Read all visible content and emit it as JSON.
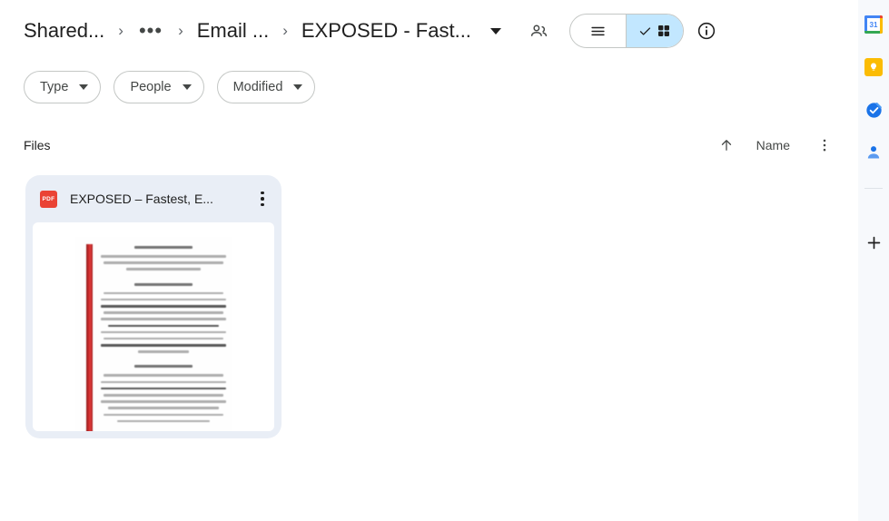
{
  "breadcrumb": {
    "items": [
      {
        "label": "Shared...",
        "name": "breadcrumb-shared"
      },
      {
        "label": "•••",
        "name": "breadcrumb-overflow"
      },
      {
        "label": "Email ...",
        "name": "breadcrumb-email"
      },
      {
        "label": "EXPOSED - Fast...",
        "name": "breadcrumb-current"
      }
    ],
    "separator": "›"
  },
  "header": {
    "share_icon": "people-share-icon",
    "dropdown_icon": "chevron-down-icon",
    "info_icon": "info-icon",
    "view_toggle": {
      "list_icon": "list-view-icon",
      "grid_icon": "grid-view-icon",
      "check_icon": "check-icon",
      "selected": "grid",
      "active_bg": "#c2e7ff"
    }
  },
  "filters": [
    {
      "label": "Type",
      "name": "filter-chip-type"
    },
    {
      "label": "People",
      "name": "filter-chip-people"
    },
    {
      "label": "Modified",
      "name": "filter-chip-modified"
    }
  ],
  "files_section": {
    "title": "Files",
    "sort_direction_icon": "arrow-up-icon",
    "sort_label": "Name",
    "sort_caret_icon": "caret-down-icon",
    "more_icon": "more-vertical-icon"
  },
  "file_cards": [
    {
      "title": "EXPOSED – Fastest, E...",
      "file_type": "PDF",
      "file_type_color": "#ea4335",
      "menu_icon": "more-vertical-icon",
      "selected": true,
      "thumbnail": "document-preview"
    }
  ],
  "side_rail": {
    "items": [
      {
        "name": "google-calendar-icon",
        "label": "31"
      },
      {
        "name": "google-keep-icon",
        "label": ""
      },
      {
        "name": "google-tasks-icon",
        "label": ""
      },
      {
        "name": "google-contacts-icon",
        "label": ""
      }
    ],
    "add_icon": "plus-icon"
  },
  "colors": {
    "card_bg": "#e9eef6",
    "rail_bg": "#f7f9fc",
    "accent_blue": "#1a73e8",
    "pdf_red": "#ea4335",
    "keep_yellow": "#fbbc04"
  }
}
